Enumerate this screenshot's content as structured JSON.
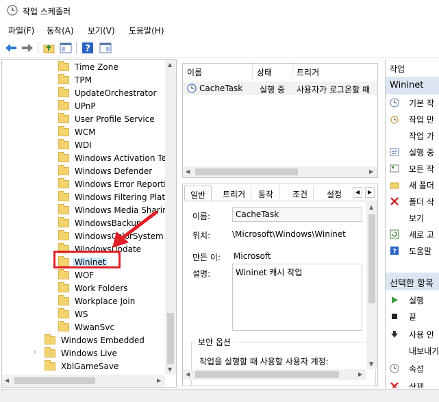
{
  "window": {
    "title": "작업 스케줄러"
  },
  "menu": {
    "file": "파일(F)",
    "action": "동작(A)",
    "view": "보기(V)",
    "help": "도움말(H)"
  },
  "tree": {
    "items": [
      "Time Zone",
      "TPM",
      "UpdateOrchestrator",
      "UPnP",
      "User Profile Service",
      "WCM",
      "WDI",
      "Windows Activation Te",
      "Windows Defender",
      "Windows Error Reportir",
      "Windows Filtering Platf",
      "Windows Media Sharir",
      "WindowsBackup",
      "WindowsColorSystem",
      "WindowsUpdate",
      "Wininet",
      "WOF",
      "Work Folders",
      "Workplace Join",
      "WS",
      "WwanSvc"
    ],
    "roots": [
      "Windows Embedded",
      "Windows Live",
      "XblGameSave"
    ]
  },
  "tasklist": {
    "columns": [
      "이름",
      "상태",
      "트리거"
    ],
    "row": {
      "name": "CacheTask",
      "status": "실행 중",
      "trigger": "사용자가 로그온할 때"
    }
  },
  "detail": {
    "tabs": [
      "일반",
      "트리거",
      "동작",
      "조건",
      "설정"
    ],
    "name_label": "이름:",
    "name_value": "CacheTask",
    "location_label": "위치:",
    "location_value": "\\Microsoft\\Windows\\Wininet",
    "author_label": "만든 이:",
    "author_value": "Microsoft",
    "desc_label": "설명:",
    "desc_value": "Wininet 캐시 작업",
    "security_title": "보안 옵션",
    "security_text": "작업을 실행할 때 사용할 사용자 계정:"
  },
  "actions": {
    "header": "작업",
    "folder_title": "Wininet",
    "folder_items": [
      "기본 작",
      "작업 만",
      "작업 가",
      "실행 중",
      "모든 작",
      "새 폴더",
      "폴더 삭",
      "보기",
      "새로 고",
      "도움말"
    ],
    "selected_title": "선택한 항목",
    "selected_items": [
      "실행",
      "끝",
      "사용 안",
      "내보내기",
      "속성",
      "삭제"
    ]
  },
  "colors": {
    "highlight": "#e01f26",
    "selected_bg": "#cce8ff",
    "section_bg": "#dce6f2"
  }
}
